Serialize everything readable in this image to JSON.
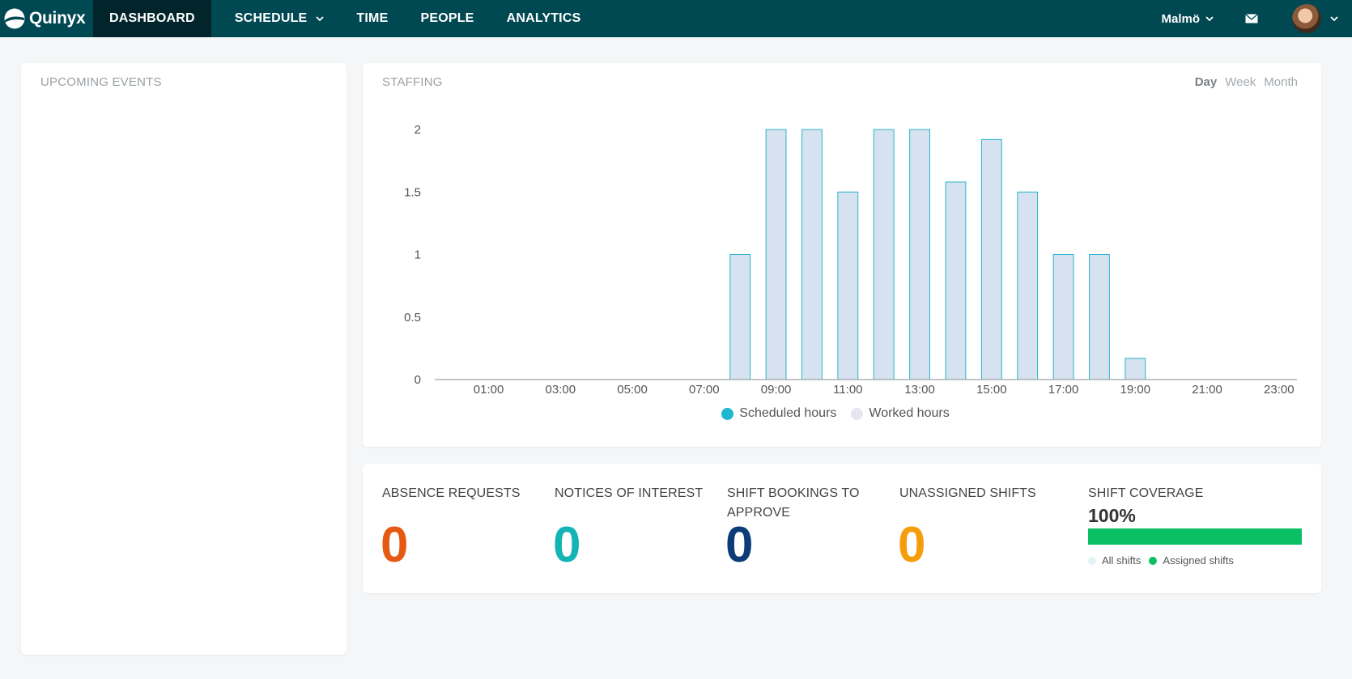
{
  "app": {
    "logo_text": "Quinyx"
  },
  "nav": {
    "items": [
      {
        "label": "DASHBOARD",
        "active": true
      },
      {
        "label": "SCHEDULE",
        "dropdown": true
      },
      {
        "label": "TIME"
      },
      {
        "label": "PEOPLE"
      },
      {
        "label": "ANALYTICS"
      }
    ],
    "location": "Malmö",
    "icons": {
      "mail": "mail-icon",
      "chevron": "chevron-down-icon"
    }
  },
  "events": {
    "title": "UPCOMING EVENTS"
  },
  "staffing": {
    "title": "STAFFING",
    "ranges": [
      {
        "label": "Day",
        "active": true
      },
      {
        "label": "Week",
        "active": false
      },
      {
        "label": "Month",
        "active": false
      }
    ],
    "legend": [
      {
        "label": "Scheduled hours",
        "color": "#1fb6d0"
      },
      {
        "label": "Worked hours",
        "color": "#e6e6ef"
      }
    ]
  },
  "chart_data": {
    "type": "bar",
    "title": "",
    "xlabel": "",
    "ylabel": "",
    "ylim": [
      0,
      2
    ],
    "yticks": [
      "0",
      "0.5",
      "1",
      "1.5",
      "2"
    ],
    "xticks": [
      "01:00",
      "03:00",
      "05:00",
      "07:00",
      "09:00",
      "11:00",
      "13:00",
      "15:00",
      "17:00",
      "19:00",
      "21:00",
      "23:00"
    ],
    "categories": [
      "00:00",
      "01:00",
      "02:00",
      "03:00",
      "04:00",
      "05:00",
      "06:00",
      "07:00",
      "08:00",
      "09:00",
      "10:00",
      "11:00",
      "12:00",
      "13:00",
      "14:00",
      "15:00",
      "16:00",
      "17:00",
      "18:00",
      "19:00",
      "20:00",
      "21:00",
      "22:00",
      "23:00"
    ],
    "series": [
      {
        "name": "Scheduled hours",
        "values": [
          0,
          0,
          0,
          0,
          0,
          0,
          0,
          0,
          1,
          2,
          2,
          1.5,
          2,
          2,
          1.58,
          1.92,
          1.5,
          1,
          1,
          0.17,
          0,
          0,
          0,
          0
        ]
      }
    ],
    "grid": false,
    "legend_position": "bottom"
  },
  "stats": [
    {
      "label": "ABSENCE REQUESTS",
      "value": "0",
      "color": "#e55a12"
    },
    {
      "label": "NOTICES OF INTEREST",
      "value": "0",
      "color": "#14b3b5"
    },
    {
      "label": "SHIFT BOOKINGS TO APPROVE",
      "value": "0",
      "color": "#0b3c77"
    },
    {
      "label": "UNASSIGNED SHIFTS",
      "value": "0",
      "color": "#f59e0b"
    }
  ],
  "coverage": {
    "title": "SHIFT COVERAGE",
    "percent_text": "100%",
    "fraction": 1.0,
    "legend": [
      {
        "label": "All shifts",
        "color": "#e6f3f6"
      },
      {
        "label": "Assigned shifts",
        "color": "#0bbf64"
      }
    ]
  }
}
